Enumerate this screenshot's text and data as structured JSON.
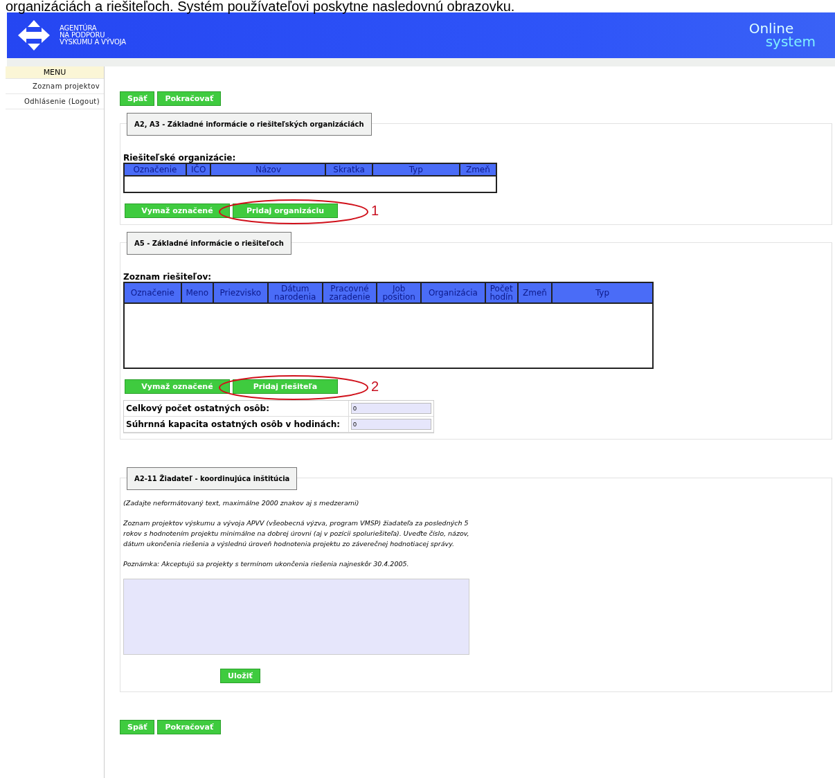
{
  "document_text": "organizáciách a riešiteľoch. Systém používateľovi poskytne nasledovnú obrazovku.",
  "header": {
    "logo_lines": [
      "AGENTÚRA",
      "NA PODPORU",
      "VÝSKUMU A VÝVOJA"
    ],
    "product_lines": [
      "Online",
      "system"
    ]
  },
  "sidebar": {
    "heading": "MENU",
    "items": [
      {
        "label": "Zoznam projektov"
      },
      {
        "label": "Odhlásenie (Logout)"
      }
    ]
  },
  "top_buttons": [
    "Späť",
    "Pokračovať"
  ],
  "sections": [
    {
      "kind": "table",
      "title": "A2, A3 - Základné informácie o riešiteľských organizáciách",
      "table_title": "Riešiteľské organizácie:",
      "columns": [
        "Označenie",
        "IČO",
        "Názov",
        "Skratka",
        "Typ",
        "Zmeň"
      ],
      "buttons": [
        "Vymaž označené",
        "Pridaj organizáciu"
      ],
      "annotation": "1"
    },
    {
      "kind": "table",
      "title": "A5 - Základné informácie o riešiteľoch",
      "table_title": "Zoznam riešiteľov:",
      "columns": [
        "Označenie",
        "Meno",
        "Priezvisko",
        "Dátum\nnarodenia",
        "Pracovné\nzaradenie",
        "Job\nposition",
        "Organizácia",
        "Počet\nhodín",
        "Zmeň",
        "Typ"
      ],
      "buttons": [
        "Vymaž označené",
        "Pridaj riešiteľa"
      ],
      "annotation": "2",
      "fields": [
        {
          "label": "Celkový počet ostatných osôb:",
          "value": "0"
        },
        {
          "label": "Súhrnná kapacita ostatných osôb v hodinách:",
          "value": "0"
        }
      ]
    },
    {
      "kind": "text",
      "title": "A2-11 Žiadateľ - koordinujúca inštitúcia",
      "paragraphs": [
        "(Zadajte neformátovaný text, maximálne 2000 znakov aj s medzerami)",
        "Zoznam projektov výskumu a vývoja APVV (všeobecná výzva, program VMSP) žiadateľa za posledných 5 rokov s hodnotením projektu minimálne na dobrej úrovni (aj v pozícii spoluriešiteľa). Uveďte číslo, názov, dátum ukončenia riešenia a výslednú úroveň hodnotenia projektu zo záverečnej hodnotiacej správy.",
        "Poznámka: Akceptujú sa projekty s termínom ukončenia riešenia najneskôr 30.4.2005."
      ],
      "save_button": "Uložiť"
    }
  ],
  "bottom_buttons": [
    "Späť",
    "Pokračovať"
  ]
}
